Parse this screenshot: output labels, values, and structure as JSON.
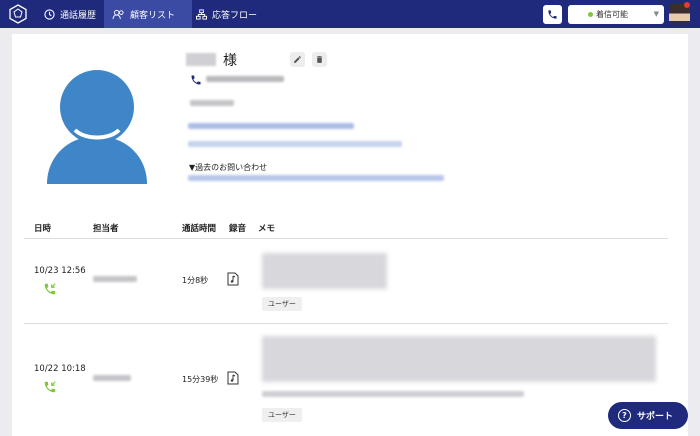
{
  "nav": {
    "items": [
      {
        "label": "通話履歴",
        "icon": "clock-icon"
      },
      {
        "label": "顧客リスト",
        "icon": "people-icon",
        "active": true
      },
      {
        "label": "応答フロー",
        "icon": "flow-icon"
      }
    ]
  },
  "header": {
    "status_label": "着信可能",
    "status_color": "#7ec83e",
    "brand_color": "#1f2a7c"
  },
  "customer": {
    "honorific": "様",
    "past_inquiries_label": "▼過去のお問い合わせ"
  },
  "history": {
    "columns": [
      "日時",
      "担当者",
      "通話時間",
      "録音",
      "メモ"
    ],
    "rows": [
      {
        "datetime": "10/23 12:56",
        "duration": "1分8秒",
        "tag": "ユーザー"
      },
      {
        "datetime": "10/22 10:18",
        "duration": "15分39秒",
        "tag": "ユーザー"
      }
    ]
  },
  "support": {
    "label": "サポート"
  }
}
